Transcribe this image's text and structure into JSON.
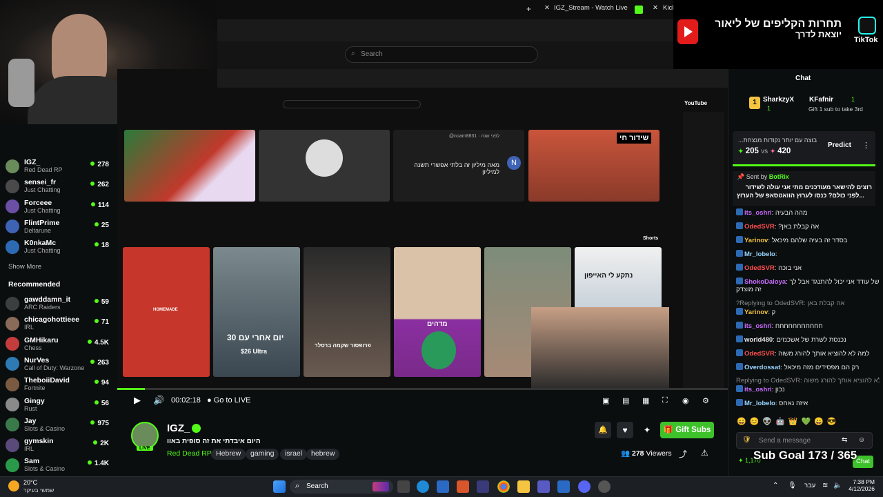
{
  "browser": {
    "tabs": [
      {
        "label": "IGZ_Stream - Watch Live on Ki"
      },
      {
        "label": "Kick"
      }
    ],
    "search_placeholder": "Search"
  },
  "tiktok_overlay": {
    "line1": "תחרות הקליפים של ליאור",
    "line2": "יוצאת לדרך",
    "brand": "TikTok"
  },
  "sidebar": {
    "following": [
      {
        "name": "IGZ_",
        "game": "Red Dead RP",
        "viewers": "278",
        "color": "#6a8b5a"
      },
      {
        "name": "sensei_fr",
        "game": "Just Chatting",
        "viewers": "262",
        "color": "#4a4a4a"
      },
      {
        "name": "Forceee",
        "game": "Just Chatting",
        "viewers": "114",
        "color": "#6b4fa5"
      },
      {
        "name": "FlintPrime",
        "game": "Deltarune",
        "viewers": "25",
        "color": "#3e63b5"
      },
      {
        "name": "K0nkaMc",
        "game": "Just Chatting",
        "viewers": "18",
        "color": "#2d6ab4"
      }
    ],
    "show_more": "Show More",
    "recommended_title": "Recommended",
    "recommended": [
      {
        "name": "gawddamn_it",
        "game": "ARC Raiders",
        "viewers": "59",
        "color": "#3c3f42"
      },
      {
        "name": "chicagohottieee",
        "game": "IRL",
        "viewers": "71",
        "color": "#8a6a58"
      },
      {
        "name": "GMHikaru",
        "game": "Chess",
        "viewers": "4.5K",
        "color": "#c43c3c"
      },
      {
        "name": "NurVes",
        "game": "Call of Duty: Warzone",
        "viewers": "263",
        "color": "#2d7ab4"
      },
      {
        "name": "TheboiiDavid",
        "game": "Fortnite",
        "viewers": "94",
        "color": "#7a5a40"
      },
      {
        "name": "Gingy",
        "game": "Rust",
        "viewers": "56",
        "color": "#8a8a8a"
      },
      {
        "name": "Jay",
        "game": "Slots & Casino",
        "viewers": "975",
        "color": "#3a7a4a"
      },
      {
        "name": "gymskin",
        "game": "IRL",
        "viewers": "2K",
        "color": "#5a4a7a"
      },
      {
        "name": "Sam",
        "game": "Slots & Casino",
        "viewers": "1.4K",
        "color": "#2a9a4a"
      }
    ]
  },
  "youtube": {
    "label": "YouTube",
    "shorts_label": "Shorts",
    "live_badge": "שידור חי",
    "post_text": "מאה מיליון זה בלתי אפשרי תשנה למיליון",
    "post_time": "לפני שנה",
    "post_user": "@noam8831",
    "thumb_captions": [
      "HOMEMADE",
      "30 יום אחרי עם",
      "$26 Ultra",
      "פרופסור שקמה ברסלר",
      "מדהים",
      "נתקע לי האייפון"
    ]
  },
  "player": {
    "time": "00:02:18",
    "go_live": "Go to LIVE"
  },
  "stream": {
    "channel": "IGZ_",
    "title": "היום איבדתי את זה סופית באוו",
    "category": "Red Dead RP",
    "tags": [
      "Hebrew",
      "gaming",
      "israel",
      "hebrew"
    ],
    "viewers": "278",
    "viewers_label": "Viewers",
    "gift_subs": "Gift Subs",
    "live_label": "LIVE"
  },
  "chat": {
    "title": "Chat",
    "top_gifters": [
      {
        "name": "SharkzyX",
        "count": "1"
      },
      {
        "name": "KFafnir",
        "count": "1"
      }
    ],
    "gift_hint": "Gift 1 sub to take 3rd",
    "prediction_title": "...בוצה עם יותר נקודות מנצחת",
    "prediction_a": "205",
    "prediction_vs": "vs",
    "prediction_b": "420",
    "predict_button": "Predict",
    "pinned_by": "Sent by",
    "pinned_user": "BotRix",
    "pinned_text_1": "רוצים להישאר מעודכנים מתי אני עולה לשידור",
    "pinned_text_2": "לפני כולם? כנסו לערוץ הוואטסאפ של הערוץ...",
    "messages": [
      {
        "user": "its_oshri",
        "text": "מהה הבעיה",
        "color": "#c86bff"
      },
      {
        "user": "OdedSVR",
        "text": "?אה קבלת באן",
        "color": "#ff4f4f"
      },
      {
        "user": "Yarinov",
        "text": "בסדר זה בעיה שלהם מיכאל",
        "color": "#f5c542"
      },
      {
        "user": "Mr_lobelo",
        "text": "",
        "color": "#9ad6ff"
      },
      {
        "user": "OdedSVR",
        "text": "אני בוכה",
        "color": "#ff4f4f"
      },
      {
        "user": "ShokoDaloya",
        "text": "לבאן של עודד אני יכול להתנגד אבל לך",
        "color": "#c86bff"
      },
      {
        "user": "",
        "text": "זה מוצדק",
        "color": "#e5e5e5"
      },
      {
        "user": "",
        "text": "?Replying to OdedSVR: אה קבלת באן",
        "color": "#8a8a8a"
      },
      {
        "user": "Yarinov",
        "text": "ק",
        "color": "#f5c542"
      },
      {
        "user": "its_oshri",
        "text": "חחחחחחחחחחח",
        "color": "#c86bff"
      },
      {
        "user": "world480",
        "text": "נכנסת לשרת של אשכנזים",
        "color": "#e5e5e5"
      },
      {
        "user": "OdedSVR",
        "text": "למה לא להוציא אותך להורג משוה",
        "color": "#ff4f4f"
      },
      {
        "user": "Overdossat",
        "text": "רק הם מפסידים מזה מיכאל",
        "color": "#9ad6ff"
      },
      {
        "user": "",
        "text": "Replying to OdedSVR: למה לא להוציא אותך להורג משוה",
        "color": "#8a8a8a"
      },
      {
        "user": "its_oshri",
        "text": "נכון",
        "color": "#c86bff"
      },
      {
        "user": "Mr_lobelo",
        "text": "איזה נאחס",
        "color": "#9ad6ff"
      }
    ],
    "send_placeholder": "Send a message",
    "chat_button": "Chat",
    "points": "1,170",
    "sub_goal": "Sub Goal 173 / 365"
  },
  "taskbar": {
    "weather_temp": "20°C",
    "weather_text": "שמשי בעיקר",
    "search": "Search",
    "lang": "עבר",
    "time": "7:38 PM",
    "date": "4/12/2026"
  },
  "colors": {
    "kick_green": "#53fc18",
    "gift_green": "#3ec22b",
    "bg": "#0b0e0f"
  }
}
